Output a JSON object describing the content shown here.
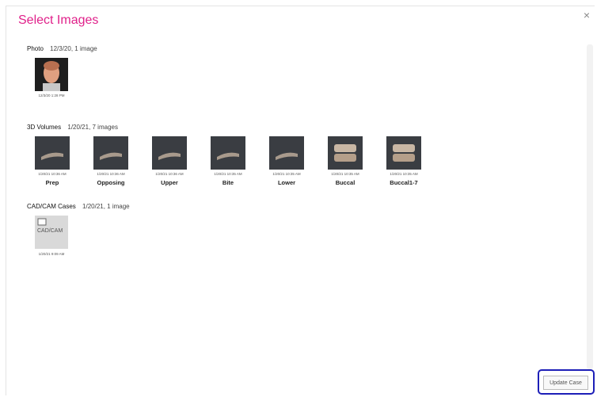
{
  "dialog": {
    "title": "Select Images",
    "close_glyph": "×"
  },
  "sections": [
    {
      "name": "Photo",
      "meta": "12/3/20, 1 image",
      "items": [
        {
          "date": "12/3/20 1:28 PM",
          "label": "",
          "icon": "face-photo-icon"
        }
      ]
    },
    {
      "name": "3D Volumes",
      "meta": "1/20/21, 7 images",
      "items": [
        {
          "date": "1/20/21 10:36 AM",
          "label": "Prep",
          "icon": "dental-volume-icon"
        },
        {
          "date": "1/20/21 10:36 AM",
          "label": "Opposing",
          "icon": "dental-volume-icon"
        },
        {
          "date": "1/20/21 10:36 AM",
          "label": "Upper",
          "icon": "dental-volume-icon"
        },
        {
          "date": "1/20/21 10:35 AM",
          "label": "Bite",
          "icon": "dental-volume-icon"
        },
        {
          "date": "1/20/21 10:35 AM",
          "label": "Lower",
          "icon": "dental-volume-icon"
        },
        {
          "date": "1/20/21 10:35 AM",
          "label": "Buccal",
          "icon": "dental-bite-icon"
        },
        {
          "date": "1/20/21 10:35 AM",
          "label": "Buccal1-7",
          "icon": "dental-bite-icon"
        }
      ]
    },
    {
      "name": "CAD/CAM Cases",
      "meta": "1/20/21, 1 image",
      "items": [
        {
          "date": "1/20/21 9:09 AM",
          "label": "",
          "thumb_text": "CAD/CAM",
          "icon": "cadcam-icon"
        }
      ]
    }
  ],
  "footer": {
    "update_label": "Update Case"
  },
  "colors": {
    "title": "#e0218a",
    "highlight_border": "#1d1fb8"
  }
}
